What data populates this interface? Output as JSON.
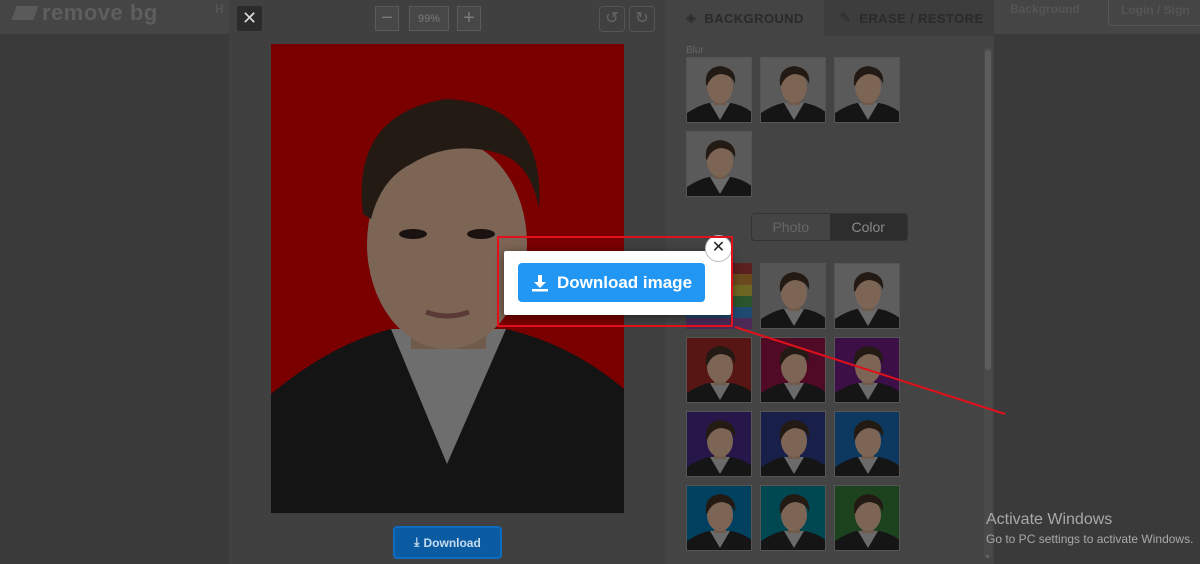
{
  "site": {
    "logo_text": "remove bg",
    "nav_fragment": "H",
    "upload_label": "Background",
    "login_label": "Login / Sign"
  },
  "editor": {
    "zoom_value": "99%",
    "zoom_out_glyph": "−",
    "zoom_in_glyph": "+",
    "close_glyph": "✕",
    "undo_glyph": "↺",
    "redo_glyph": "↻",
    "download_label": "Download"
  },
  "panel": {
    "tab_background": "BACKGROUND",
    "tab_erase": "ERASE / RESTORE",
    "blur_label": "Blur",
    "segment_photo": "Photo",
    "segment_color": "Color"
  },
  "popup": {
    "download_image_label": "Download image",
    "close_glyph": "✕"
  },
  "color_swatches": [
    "#d0312d",
    "#c2185b",
    "#8e24aa",
    "#5e35b1",
    "#3949ab",
    "#1e88e5",
    "#039be5",
    "#00acc1",
    "#43a047"
  ],
  "rainbow_colors": [
    "#e53935",
    "#fb8c00",
    "#fdd835",
    "#43a047",
    "#1e88e5",
    "#8e24aa"
  ],
  "watermark": {
    "title": "Activate Windows",
    "subtitle": "Go to PC settings to activate Windows."
  },
  "colors": {
    "accent": "#2196f3",
    "highlight_red": "#e0111b",
    "photo_bg": "#ff0000"
  }
}
